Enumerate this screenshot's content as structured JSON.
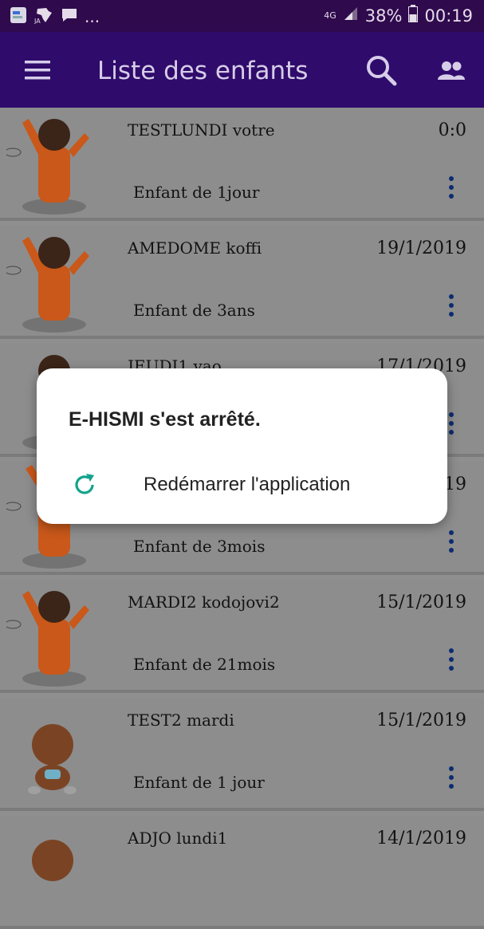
{
  "status_bar": {
    "battery": "38%",
    "time": "00:19",
    "network": "4G",
    "overflow": "...",
    "icons": [
      "gallery-icon",
      "africa-map-icon",
      "message-icon",
      "signal-icon",
      "battery-icon"
    ]
  },
  "app_bar": {
    "title": "Liste des enfants",
    "icons": [
      "menu-icon",
      "search-icon",
      "group-icon"
    ],
    "color": "#2f0b6b"
  },
  "children": [
    {
      "name": "TESTLUNDI votre",
      "date": "0:0",
      "age": "Enfant de 1jour",
      "avatar": "cartoon-child-icon"
    },
    {
      "name": "AMEDOME koffi",
      "date": "19/1/2019",
      "age": "Enfant de 3ans",
      "avatar": "cartoon-child-icon"
    },
    {
      "name": "JEUDI1 yao",
      "date": "17/1/2019",
      "age": "",
      "avatar": "cartoon-child-icon"
    },
    {
      "name": "",
      "date": "19",
      "age": "Enfant de 3mois",
      "avatar": "cartoon-child-icon"
    },
    {
      "name": "MARDI2 kodojovi2",
      "date": "15/1/2019",
      "age": "Enfant de 21mois",
      "avatar": "cartoon-child-icon"
    },
    {
      "name": "TEST2 mardi",
      "date": "15/1/2019",
      "age": "Enfant de 1 jour",
      "avatar": "baby-icon"
    },
    {
      "name": "ADJO lundi1",
      "date": "14/1/2019",
      "age": "",
      "avatar": "baby-icon"
    }
  ],
  "dialog": {
    "title": "E-HISMI s'est arrêté.",
    "action_label": "Redémarrer l'application",
    "action_icon": "refresh-icon",
    "accent": "#13a38b"
  }
}
